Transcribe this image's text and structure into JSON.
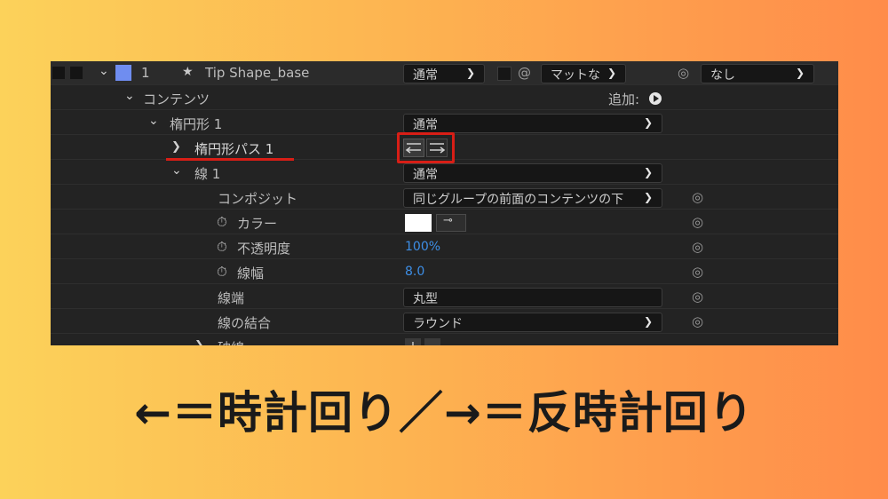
{
  "header": {
    "layer_number": "1",
    "layer_name": "Tip Shape_base",
    "blend_mode": "通常",
    "matte": "マットな",
    "parent": "なし"
  },
  "rows": {
    "contents": "コンテンツ",
    "add_label": "追加:",
    "ellipse": "楕円形 1",
    "ellipse_mode": "通常",
    "ellipse_path": "楕円形パス 1",
    "stroke": "線 1",
    "stroke_mode": "通常",
    "composite": "コンポジット",
    "composite_value": "同じグループの前面のコンテンツの下",
    "color": "カラー",
    "opacity": "不透明度",
    "opacity_value": "100%",
    "width": "線幅",
    "width_value": "8.0",
    "cap": "線端",
    "cap_value": "丸型",
    "join": "線の結合",
    "join_value": "ラウンド",
    "dash": "破線"
  },
  "caption": "←＝時計回り／→＝反時計回り",
  "colors": {
    "accent_red": "#d81e16",
    "value_blue": "#3d8ee6",
    "layer_label": "#6f8df0"
  }
}
